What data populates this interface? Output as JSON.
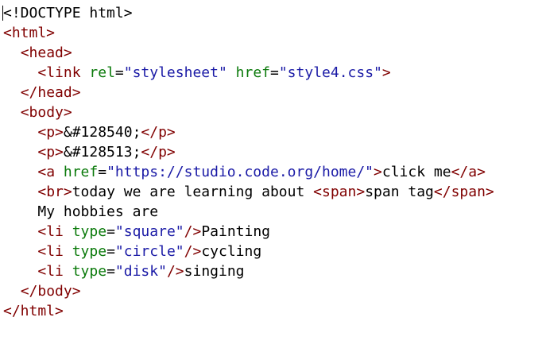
{
  "editor": {
    "lines": [
      {
        "indent": "",
        "tokens": [
          {
            "t": "<!DOCTYPE html>",
            "c": "text"
          }
        ]
      },
      {
        "indent": "",
        "tokens": [
          {
            "t": "<html>",
            "c": "tag"
          }
        ]
      },
      {
        "indent": "  ",
        "tokens": [
          {
            "t": "<head>",
            "c": "tag"
          }
        ]
      },
      {
        "indent": "    ",
        "tokens": [
          {
            "t": "<link ",
            "c": "tag"
          },
          {
            "t": "rel",
            "c": "attr"
          },
          {
            "t": "=",
            "c": "text"
          },
          {
            "t": "\"stylesheet\"",
            "c": "str"
          },
          {
            "t": " ",
            "c": "text"
          },
          {
            "t": "href",
            "c": "attr"
          },
          {
            "t": "=",
            "c": "text"
          },
          {
            "t": "\"style4.css\"",
            "c": "str"
          },
          {
            "t": ">",
            "c": "tag"
          }
        ]
      },
      {
        "indent": "  ",
        "tokens": [
          {
            "t": "</head>",
            "c": "tag"
          }
        ]
      },
      {
        "indent": "  ",
        "tokens": [
          {
            "t": "<body>",
            "c": "tag"
          }
        ]
      },
      {
        "indent": "    ",
        "tokens": [
          {
            "t": "<p>",
            "c": "tag"
          },
          {
            "t": "&#128540;",
            "c": "text"
          },
          {
            "t": "</p>",
            "c": "tag"
          }
        ]
      },
      {
        "indent": "    ",
        "tokens": [
          {
            "t": "<p>",
            "c": "tag"
          },
          {
            "t": "&#128513;",
            "c": "text"
          },
          {
            "t": "</p>",
            "c": "tag"
          }
        ]
      },
      {
        "indent": "    ",
        "tokens": [
          {
            "t": "<a ",
            "c": "tag"
          },
          {
            "t": "href",
            "c": "attr"
          },
          {
            "t": "=",
            "c": "text"
          },
          {
            "t": "\"https://studio.code.org/home/\"",
            "c": "str"
          },
          {
            "t": ">",
            "c": "tag"
          },
          {
            "t": "click me",
            "c": "text"
          },
          {
            "t": "</a>",
            "c": "tag"
          }
        ]
      },
      {
        "indent": "    ",
        "tokens": [
          {
            "t": "<br>",
            "c": "tag"
          },
          {
            "t": "today we are learning about ",
            "c": "text"
          },
          {
            "t": "<span>",
            "c": "tag"
          },
          {
            "t": "span tag",
            "c": "text"
          },
          {
            "t": "</span>",
            "c": "tag"
          }
        ]
      },
      {
        "indent": "    ",
        "tokens": [
          {
            "t": "My hobbies are",
            "c": "text"
          }
        ]
      },
      {
        "indent": "    ",
        "tokens": [
          {
            "t": "<li ",
            "c": "tag"
          },
          {
            "t": "type",
            "c": "attr"
          },
          {
            "t": "=",
            "c": "text"
          },
          {
            "t": "\"square\"",
            "c": "str"
          },
          {
            "t": "/>",
            "c": "tag"
          },
          {
            "t": "Painting",
            "c": "text"
          }
        ]
      },
      {
        "indent": "    ",
        "tokens": [
          {
            "t": "<li ",
            "c": "tag"
          },
          {
            "t": "type",
            "c": "attr"
          },
          {
            "t": "=",
            "c": "text"
          },
          {
            "t": "\"circle\"",
            "c": "str"
          },
          {
            "t": "/>",
            "c": "tag"
          },
          {
            "t": "cycling",
            "c": "text"
          }
        ]
      },
      {
        "indent": "    ",
        "tokens": [
          {
            "t": "<li ",
            "c": "tag"
          },
          {
            "t": "type",
            "c": "attr"
          },
          {
            "t": "=",
            "c": "text"
          },
          {
            "t": "\"disk\"",
            "c": "str"
          },
          {
            "t": "/>",
            "c": "tag"
          },
          {
            "t": "singing",
            "c": "text"
          }
        ]
      },
      {
        "indent": "  ",
        "tokens": [
          {
            "t": "</body>",
            "c": "tag"
          }
        ]
      },
      {
        "indent": "",
        "tokens": [
          {
            "t": "</html>",
            "c": "tag"
          }
        ]
      }
    ]
  },
  "colors": {
    "tag": "#800000",
    "attribute": "#0b7a0b",
    "string": "#1a1aa6",
    "text": "#000000",
    "background": "#ffffff"
  }
}
